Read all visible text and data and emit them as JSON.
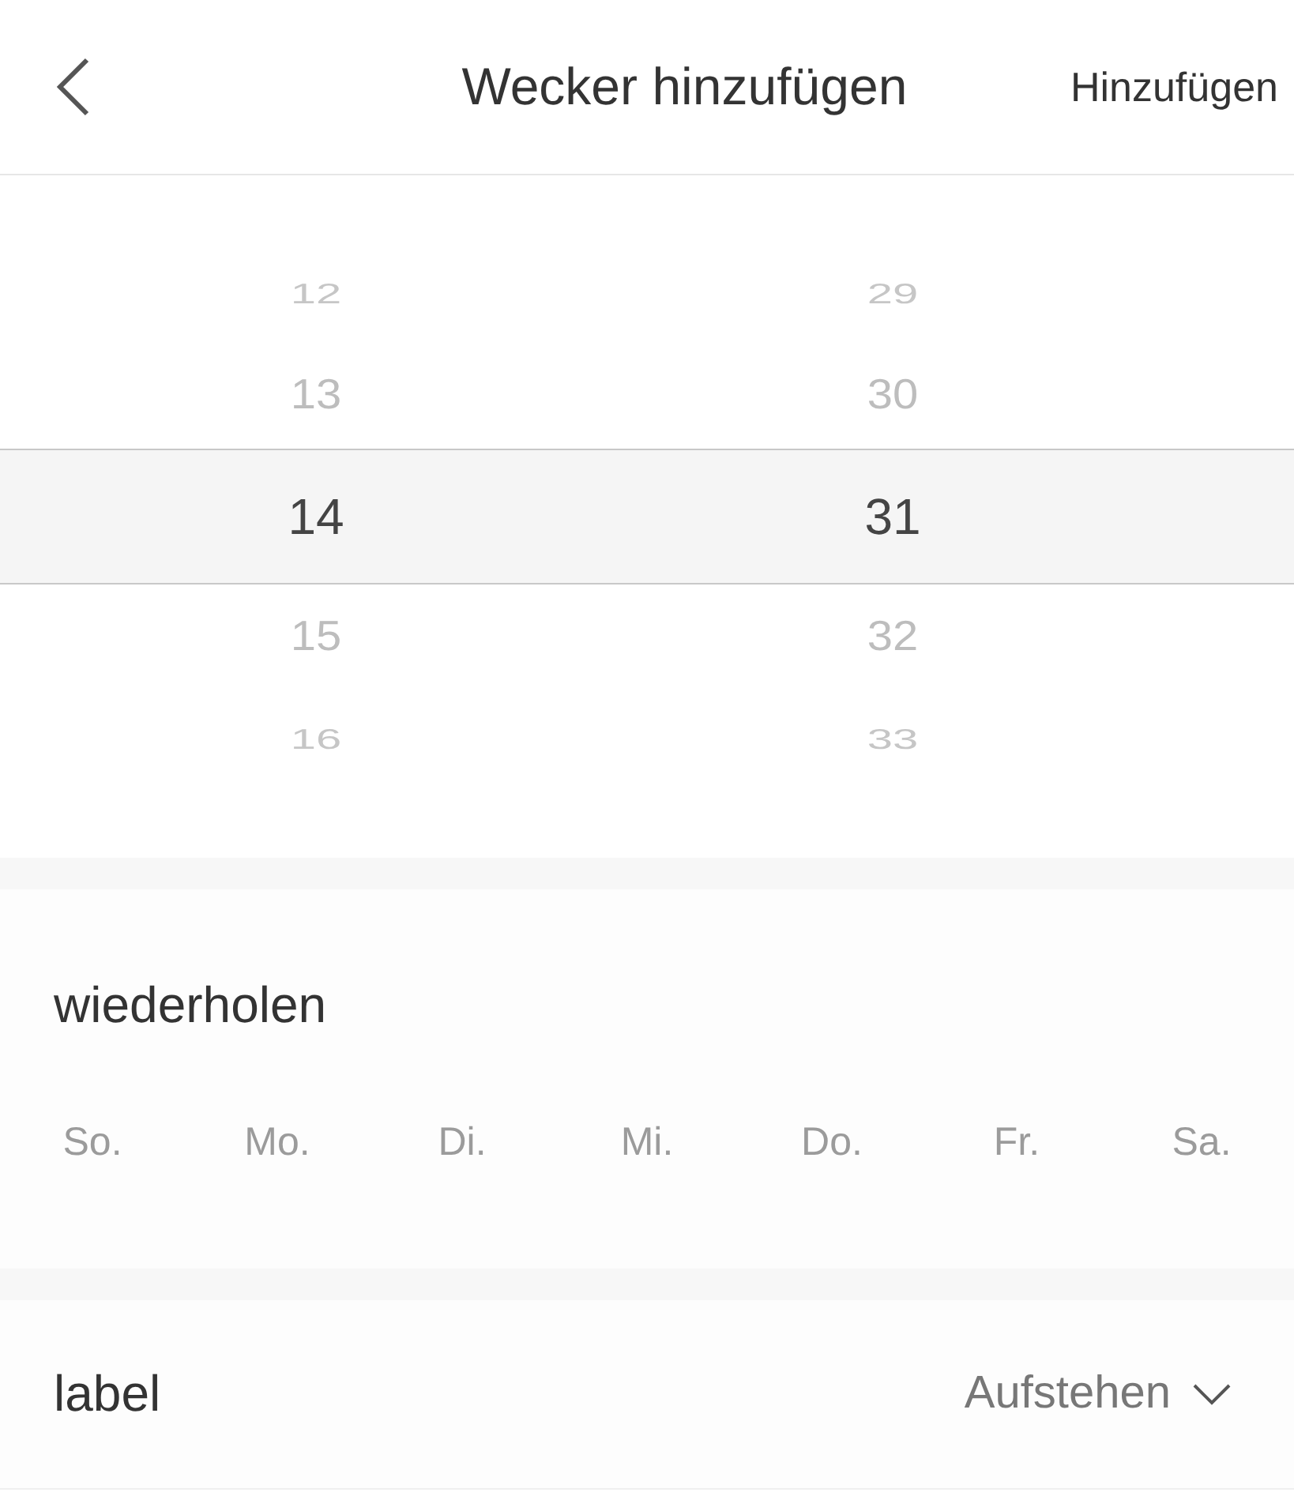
{
  "header": {
    "title": "Wecker hinzufügen",
    "action": "Hinzufügen"
  },
  "picker": {
    "hours": [
      {
        "value": "12",
        "selected": false
      },
      {
        "value": "13",
        "selected": false
      },
      {
        "value": "14",
        "selected": true
      },
      {
        "value": "15",
        "selected": false
      },
      {
        "value": "16",
        "selected": false
      }
    ],
    "minutes": [
      {
        "value": "29",
        "selected": false
      },
      {
        "value": "30",
        "selected": false
      },
      {
        "value": "31",
        "selected": true
      },
      {
        "value": "32",
        "selected": false
      },
      {
        "value": "33",
        "selected": false
      }
    ]
  },
  "repeat": {
    "title": "wiederholen",
    "days": [
      {
        "label": "So.",
        "selected": false
      },
      {
        "label": "Mo.",
        "selected": false
      },
      {
        "label": "Di.",
        "selected": false
      },
      {
        "label": "Mi.",
        "selected": false
      },
      {
        "label": "Do.",
        "selected": false
      },
      {
        "label": "Fr.",
        "selected": false
      },
      {
        "label": "Sa.",
        "selected": false
      }
    ]
  },
  "label": {
    "title": "label",
    "value": "Aufstehen"
  }
}
